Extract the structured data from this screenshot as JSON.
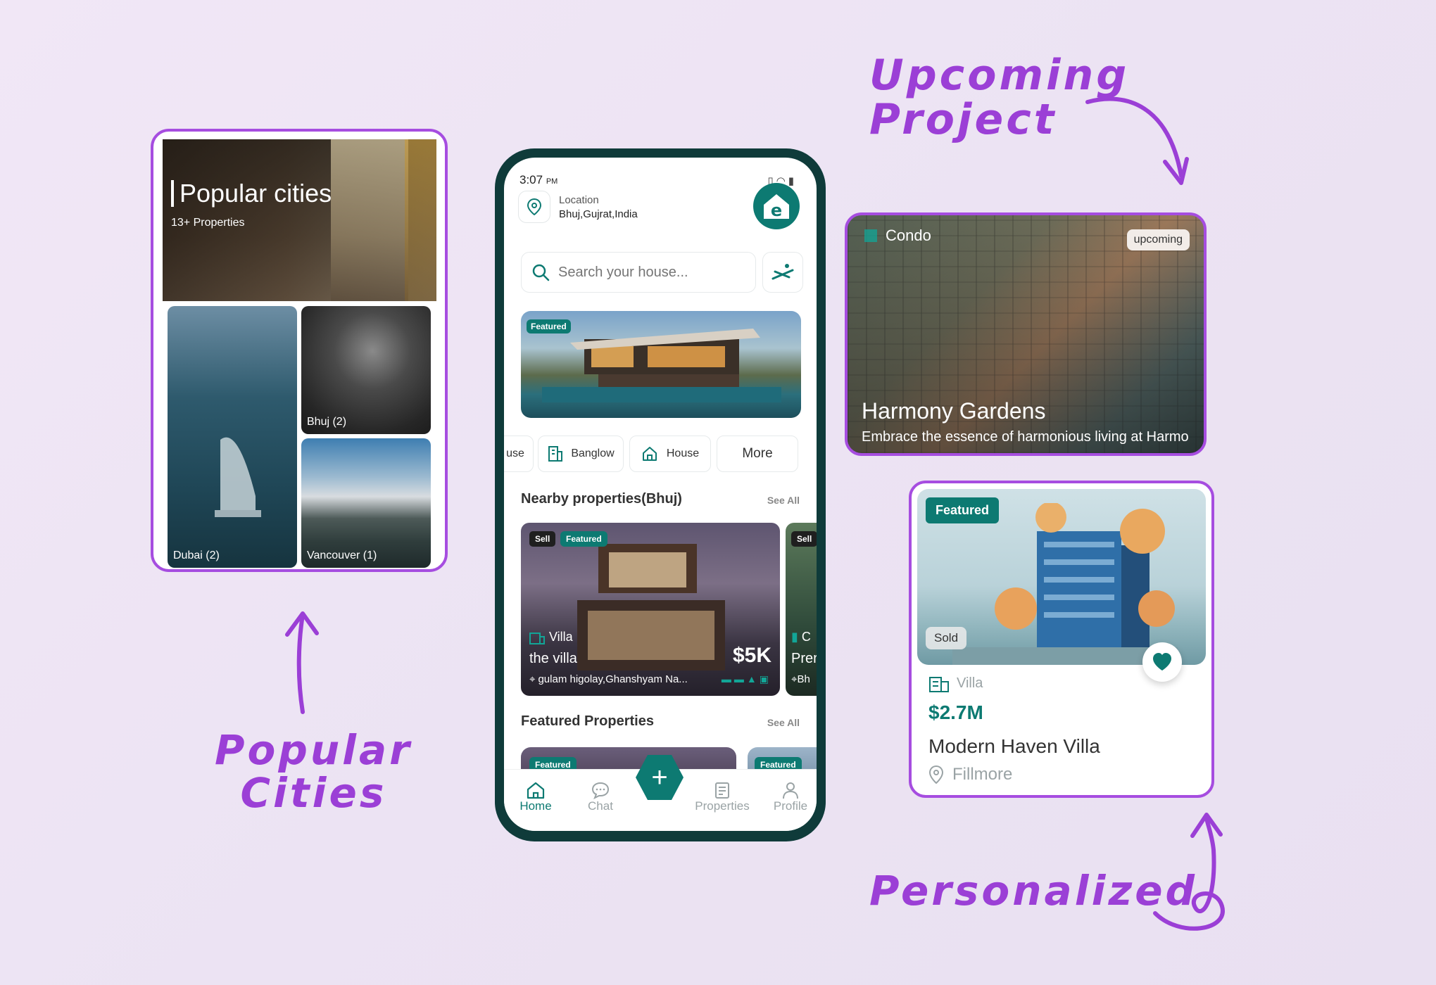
{
  "annotations": {
    "upcoming": "Upcoming\nProject",
    "popular": "Popular\nCities",
    "personalized": "Personalized"
  },
  "popular_cities_card": {
    "title": "Popular cities",
    "subtitle": "13+ Properties",
    "tiles": [
      {
        "label": "Dubai (2)"
      },
      {
        "label": "Bhuj (2)"
      },
      {
        "label": "Vancouver (1)"
      }
    ]
  },
  "phone": {
    "status": {
      "time": "3:07",
      "ampm": "PM"
    },
    "location": {
      "label": "Location",
      "value": "Bhuj,Gujrat,India"
    },
    "search": {
      "placeholder": "Search your house..."
    },
    "banner": {
      "badge": "Featured"
    },
    "categories": [
      {
        "label": "use"
      },
      {
        "label": "Banglow",
        "icon": "building-icon"
      },
      {
        "label": "House",
        "icon": "home-icon"
      },
      {
        "label": "More"
      }
    ],
    "nearby": {
      "title": "Nearby properties(Bhuj)",
      "see_all": "See All",
      "cards": [
        {
          "tags": [
            "Sell",
            "Featured"
          ],
          "type": "Villa",
          "name": "the villa",
          "price": "$5K",
          "address": "gulam higolay,Ghanshyam Na..."
        },
        {
          "tags": [
            "Sell"
          ],
          "type": "C",
          "name": "Prer",
          "address": "Bh"
        }
      ]
    },
    "featured": {
      "title": "Featured Properties",
      "see_all": "See All",
      "badges": [
        "Featured",
        "Featured"
      ]
    },
    "nav": [
      {
        "label": "Home",
        "icon": "home-icon",
        "active": true
      },
      {
        "label": "Chat",
        "icon": "chat-icon"
      },
      {
        "label": "Properties",
        "icon": "properties-icon"
      },
      {
        "label": "Profile",
        "icon": "profile-icon"
      }
    ],
    "fab": "+"
  },
  "upcoming_card": {
    "type": "Condo",
    "badge": "upcoming",
    "title": "Harmony Gardens",
    "description": "Embrace the essence of harmonious living at Harmo"
  },
  "personalized_card": {
    "badge": "Featured",
    "status": "Sold",
    "type": "Villa",
    "price": "$2.7M",
    "name": "Modern Haven Villa",
    "location": "Fillmore"
  },
  "colors": {
    "accent": "#0d7a72",
    "frame": "#a64de0",
    "annotation": "#9b3fd6"
  }
}
